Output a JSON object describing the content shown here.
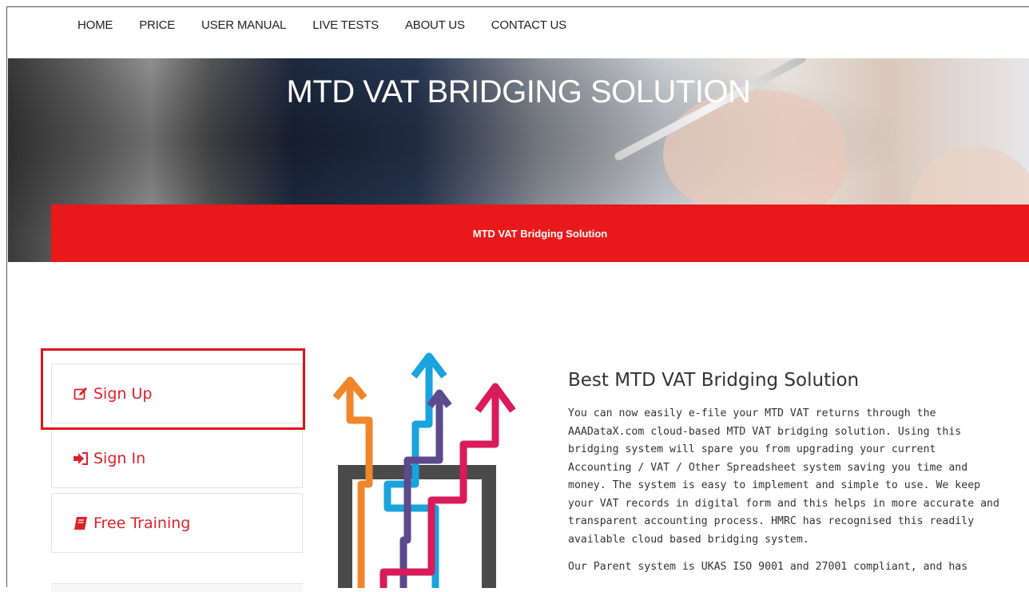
{
  "nav": {
    "items": [
      "HOME",
      "PRICE",
      "USER MANUAL",
      "LIVE TESTS",
      "ABOUT US",
      "CONTACT US"
    ]
  },
  "hero": {
    "title": "MTD VAT BRIDGING SOLUTION",
    "breadcrumb": "MTD VAT Bridging Solution"
  },
  "sidebar": {
    "sign_up": "Sign Up",
    "sign_in": "Sign In",
    "free_training": "Free Training",
    "sign_up_icon": "edit-icon",
    "sign_in_icon": "sign-in-icon",
    "free_training_icon": "book-icon"
  },
  "main": {
    "heading": "Best MTD VAT Bridging Solution",
    "paragraph1": "You can now easily e-file your MTD VAT returns through the AAADataX.com cloud-based MTD VAT bridging solution. Using this bridging system will spare you from upgrading your current Accounting / VAT / Other Spreadsheet system saving you time and money. The system is easy to implement and simple to use. We keep your VAT records in digital form and this helps in more accurate and transparent accounting process. HMRC has recognised this readily available cloud based bridging system.",
    "paragraph2": "Our Parent system is UKAS ISO 9001 and 27001 compliant, and has"
  },
  "colors": {
    "accent_red": "#e8181b",
    "link_red": "#d9222a",
    "arrow_orange": "#f0862a",
    "arrow_blue": "#1aa3dc",
    "arrow_purple": "#5b4a8c",
    "arrow_pink": "#d91a5b",
    "frame_gray": "#4a4a4a"
  }
}
